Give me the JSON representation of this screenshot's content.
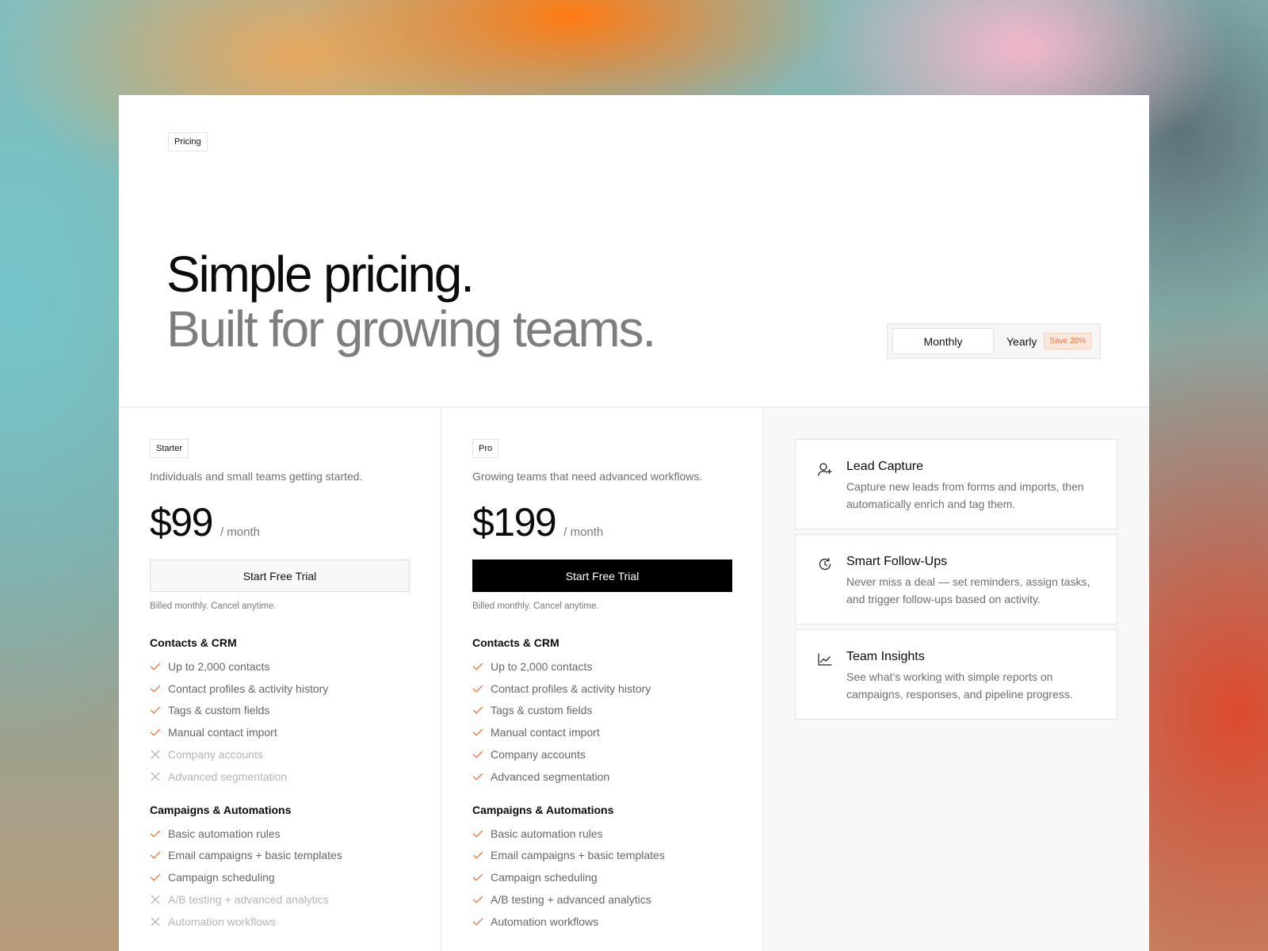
{
  "hero": {
    "tag": "Pricing",
    "headline_line1": "Simple pricing.",
    "headline_line2": "Built for growing teams."
  },
  "billing_toggle": {
    "monthly_label": "Monthly",
    "yearly_label": "Yearly",
    "save_badge": "Save 20%",
    "selected": "Monthly"
  },
  "colors": {
    "accent": "#e9703a",
    "check": "#e9703a",
    "cross": "#b5b5b5",
    "primary_button": "#000000"
  },
  "plans": [
    {
      "name": "Starter",
      "description": "Individuals and small teams getting started.",
      "price": "$99",
      "period": "/ month",
      "cta": "Start Free Trial",
      "billing_note": "Billed monthly. Cancel anytime.",
      "sections": [
        {
          "title": "Contacts & CRM",
          "features": [
            {
              "text": "Up to 2,000 contacts",
              "included": true
            },
            {
              "text": "Contact profiles & activity history",
              "included": true
            },
            {
              "text": "Tags & custom fields",
              "included": true
            },
            {
              "text": "Manual contact import",
              "included": true
            },
            {
              "text": "Company accounts",
              "included": false
            },
            {
              "text": "Advanced segmentation",
              "included": false
            }
          ]
        },
        {
          "title": "Campaigns & Automations",
          "features": [
            {
              "text": "Basic automation rules",
              "included": true
            },
            {
              "text": "Email campaigns + basic templates",
              "included": true
            },
            {
              "text": "Campaign scheduling",
              "included": true
            },
            {
              "text": "A/B testing + advanced analytics",
              "included": false
            },
            {
              "text": "Automation workflows",
              "included": false
            }
          ]
        }
      ]
    },
    {
      "name": "Pro",
      "description": "Growing teams that need advanced workflows.",
      "price": "$199",
      "period": "/ month",
      "cta": "Start Free Trial",
      "billing_note": "Billed monthly. Cancel anytime.",
      "sections": [
        {
          "title": "Contacts & CRM",
          "features": [
            {
              "text": "Up to 2,000 contacts",
              "included": true
            },
            {
              "text": "Contact profiles & activity history",
              "included": true
            },
            {
              "text": "Tags & custom fields",
              "included": true
            },
            {
              "text": "Manual contact import",
              "included": true
            },
            {
              "text": "Company accounts",
              "included": true
            },
            {
              "text": "Advanced segmentation",
              "included": true
            }
          ]
        },
        {
          "title": "Campaigns & Automations",
          "features": [
            {
              "text": "Basic automation rules",
              "included": true
            },
            {
              "text": "Email campaigns + basic templates",
              "included": true
            },
            {
              "text": "Campaign scheduling",
              "included": true
            },
            {
              "text": "A/B testing + advanced analytics",
              "included": true
            },
            {
              "text": "Automation workflows",
              "included": true
            }
          ]
        }
      ]
    }
  ],
  "highlights": [
    {
      "icon": "user-plus-icon",
      "title": "Lead Capture",
      "text": "Capture new leads from forms and imports, then automatically enrich and tag them."
    },
    {
      "icon": "clock-refresh-icon",
      "title": "Smart Follow-Ups",
      "text": "Never miss a deal — set reminders, assign tasks, and trigger follow-ups based on activity."
    },
    {
      "icon": "line-chart-icon",
      "title": "Team Insights",
      "text": "See what’s working with simple reports on campaigns, responses, and pipeline progress."
    }
  ]
}
